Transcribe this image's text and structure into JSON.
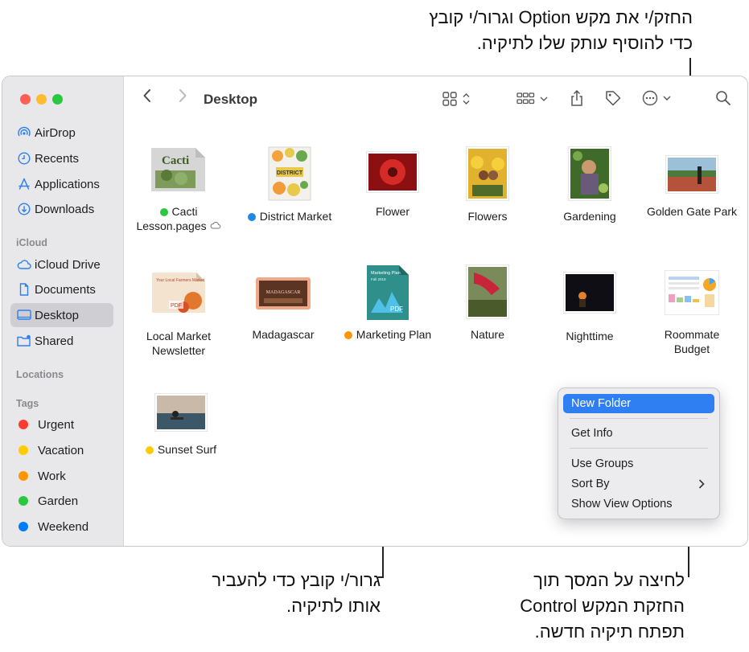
{
  "callouts": {
    "top": [
      "החזק/י את מקש Option וגרור/י קובץ",
      "כדי להוסיף עותק שלו לתיקיה."
    ],
    "bottom_left": [
      "גרור/י קובץ כדי להעביר",
      "אותו לתיקיה."
    ],
    "bottom_right": [
      "לחיצה על המסך תוך",
      "החזקת המקש Control",
      "תפתח תיקיה חדשה."
    ]
  },
  "window": {
    "title": "Desktop",
    "traffic_lights": [
      "#ff5f57",
      "#febc2e",
      "#28c840"
    ]
  },
  "sidebar": {
    "favorites": [
      {
        "label": "AirDrop",
        "icon": "airdrop-icon"
      },
      {
        "label": "Recents",
        "icon": "clock-icon"
      },
      {
        "label": "Applications",
        "icon": "applications-icon"
      },
      {
        "label": "Downloads",
        "icon": "download-icon"
      }
    ],
    "icloud_heading": "iCloud",
    "icloud": [
      {
        "label": "iCloud Drive",
        "icon": "cloud-icon"
      },
      {
        "label": "Documents",
        "icon": "document-icon"
      },
      {
        "label": "Desktop",
        "icon": "desktop-icon",
        "selected": true
      },
      {
        "label": "Shared",
        "icon": "shared-folder-icon"
      }
    ],
    "locations_heading": "Locations",
    "tags_heading": "Tags",
    "tags": [
      {
        "label": "Urgent",
        "color": "#ff3b30"
      },
      {
        "label": "Vacation",
        "color": "#ffcc00"
      },
      {
        "label": "Work",
        "color": "#ff9500"
      },
      {
        "label": "Garden",
        "color": "#28c840"
      },
      {
        "label": "Weekend",
        "color": "#007aff"
      }
    ]
  },
  "files": [
    {
      "name_line1": "Cacti",
      "name_line2": "Lesson.pages",
      "tag": "#28c840"
    },
    {
      "name_line1": "District Market",
      "name_line2": "",
      "tag": "#1e88e5"
    },
    {
      "name_line1": "Flower",
      "name_line2": ""
    },
    {
      "name_line1": "Flowers",
      "name_line2": ""
    },
    {
      "name_line1": "Gardening",
      "name_line2": ""
    },
    {
      "name_line1": "Golden Gate Park",
      "name_line2": ""
    },
    {
      "name_line1": "Local Market",
      "name_line2": "Newsletter"
    },
    {
      "name_line1": "Madagascar",
      "name_line2": ""
    },
    {
      "name_line1": "Marketing Plan",
      "name_line2": "",
      "tag": "#ff9500"
    },
    {
      "name_line1": "Nature",
      "name_line2": ""
    },
    {
      "name_line1": "Nighttime",
      "name_line2": ""
    },
    {
      "name_line1": "Roommate",
      "name_line2": "Budget"
    },
    {
      "name_line1": "Sunset Surf",
      "name_line2": "",
      "tag": "#ffcc00"
    }
  ],
  "thumb_texts": {
    "cacti": "Cacti",
    "district": "DISTRICT",
    "marketing": "Marketing Plan",
    "marketing_sub": "Fall 2019",
    "pdf": "PDF",
    "local_title": "Your Local Farmers Market",
    "madagascar": "MADAGASCAR"
  },
  "context_menu": {
    "items": [
      "New Folder",
      "Get Info",
      "Use Groups",
      "Sort By",
      "Show View Options"
    ],
    "highlighted": "New Folder"
  }
}
